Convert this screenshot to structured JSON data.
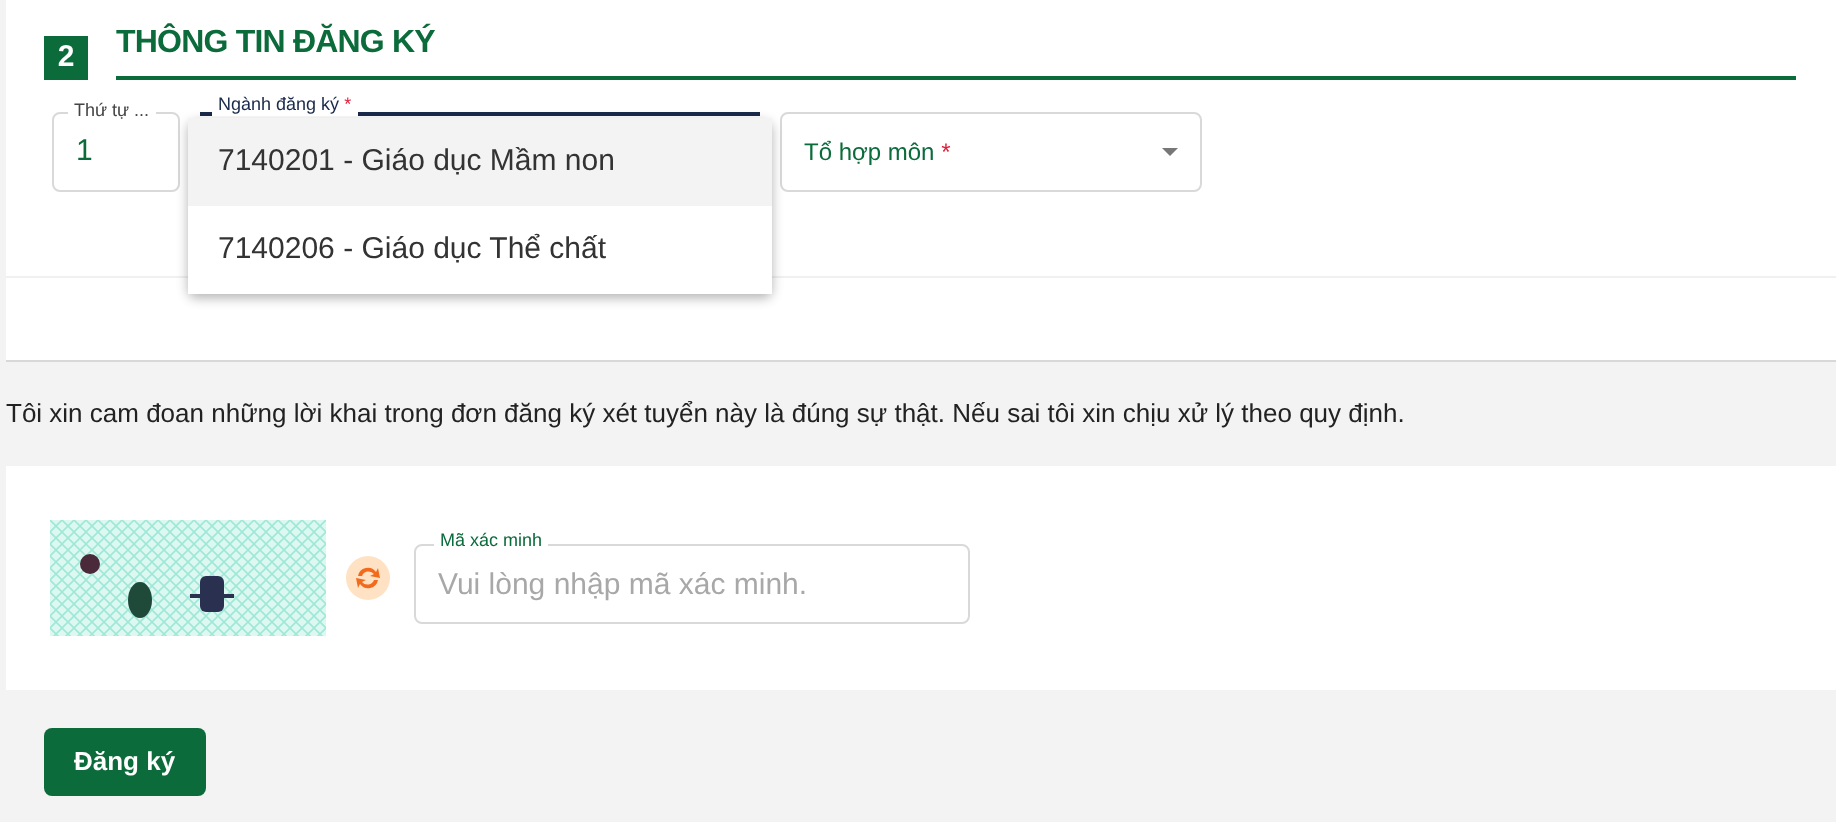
{
  "section": {
    "number": "2",
    "title": "THÔNG TIN ĐĂNG KÝ"
  },
  "fields": [
    {
      "kind": "text",
      "label": "Thứ tự ...",
      "value": "1"
    },
    {
      "kind": "dropdown-open",
      "label": "Ngành đăng ký",
      "required_mark": "*"
    },
    {
      "kind": "select",
      "placeholder": "Tổ hợp môn",
      "required_mark": "*"
    }
  ],
  "dropdown_options": [
    {
      "label": "7140201 - Giáo dục Mầm non",
      "selected": true
    },
    {
      "label": "7140206 - Giáo dục Thể chất",
      "selected": false
    }
  ],
  "declaration": "Tôi xin cam đoan những lời khai trong đơn đăng ký xét tuyển này là đúng sự thật. Nếu sai tôi xin chịu xử lý theo quy định.",
  "captcha": {
    "label": "Mã xác minh",
    "placeholder": "Vui lòng nhập mã xác minh."
  },
  "submit_button": "Đăng ký"
}
